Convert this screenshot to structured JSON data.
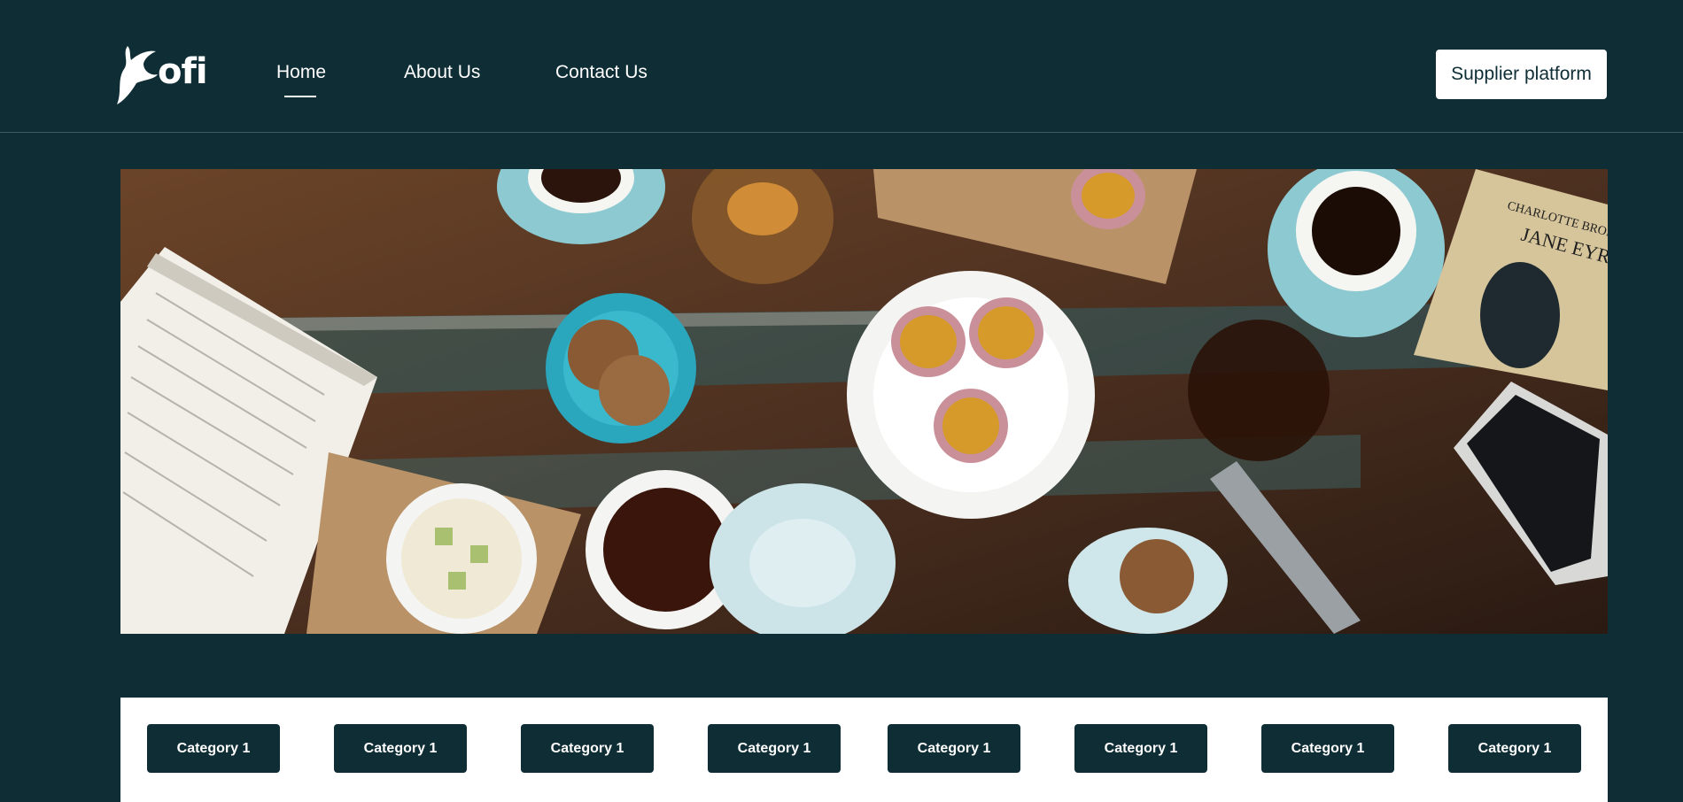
{
  "brand": {
    "name": "ofi"
  },
  "nav": {
    "items": [
      {
        "label": "Home",
        "active": true
      },
      {
        "label": "About Us",
        "active": false
      },
      {
        "label": "Contact Us",
        "active": false
      }
    ],
    "cta_label": "Supplier platform"
  },
  "hero": {
    "image": "coffee-table-flatlay",
    "book_title": "JANE EYRE",
    "book_author": "CHARLOTTE BRONTË"
  },
  "categories": [
    {
      "label": "Category 1"
    },
    {
      "label": "Category 1"
    },
    {
      "label": "Category 1"
    },
    {
      "label": "Category 1"
    },
    {
      "label": "Category 1"
    },
    {
      "label": "Category 1"
    },
    {
      "label": "Category 1"
    },
    {
      "label": "Category 1"
    }
  ],
  "colors": {
    "background": "#0f2d35",
    "button_bg": "#0f2d35",
    "surface": "#ffffff"
  }
}
